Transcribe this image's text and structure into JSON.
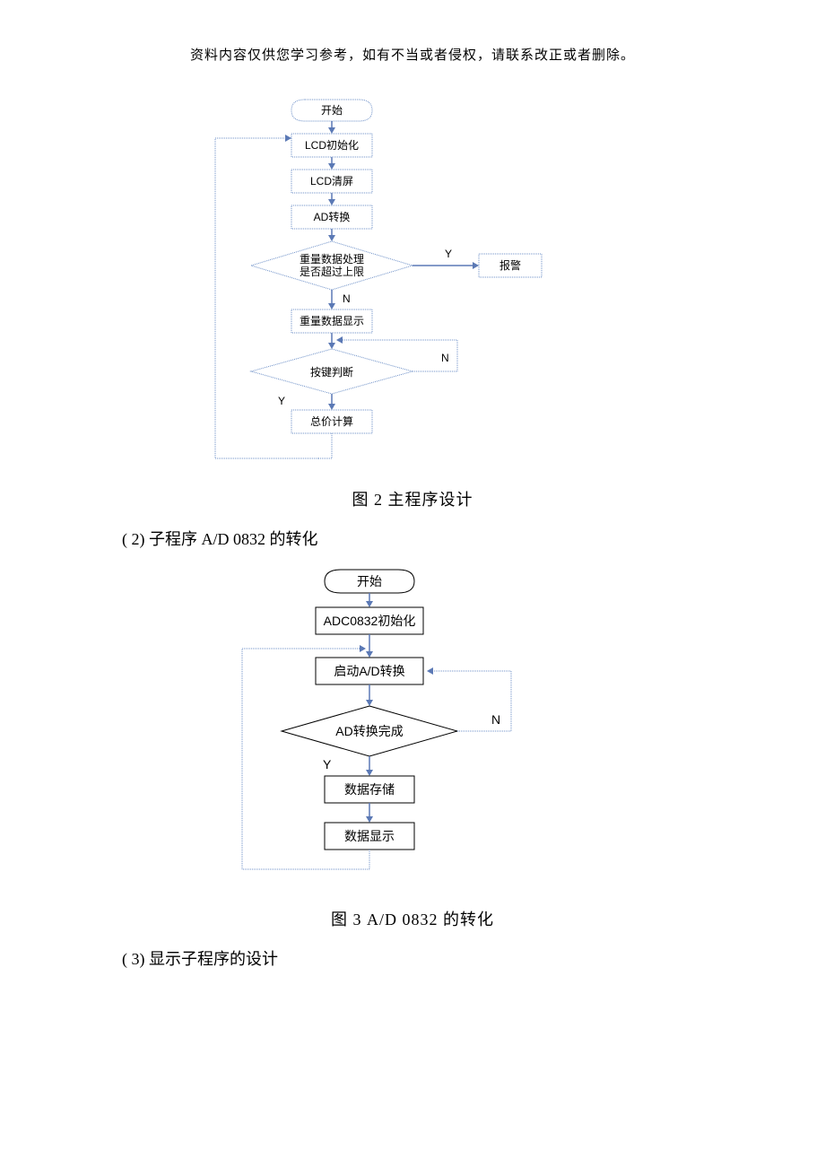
{
  "header": {
    "note": "资料内容仅供您学习参考，如有不当或者侵权，请联系改正或者删除。"
  },
  "flowchart1": {
    "start": "开始",
    "lcd_init": "LCD初始化",
    "lcd_clear": "LCD清屏",
    "ad_convert": "AD转换",
    "weight_process_line1": "重量数据处理",
    "weight_process_line2": "是否超过上限",
    "alarm": "报警",
    "weight_display": "重量数据显示",
    "key_check": "按键判断",
    "total_calc": "总价计算",
    "yes": "Y",
    "no": "N",
    "caption": "图 2   主程序设计"
  },
  "section2": {
    "heading": "( 2)  子程序 A/D 0832 的转化"
  },
  "flowchart2": {
    "start": "开始",
    "adc_init": "ADC0832初始化",
    "start_ad": "启动A/D转换",
    "ad_done": "AD转换完成",
    "data_store": "数据存储",
    "data_display": "数据显示",
    "yes": "Y",
    "no": "N",
    "caption": "图 3    A/D 0832 的转化"
  },
  "section3": {
    "heading": "( 3)  显示子程序的设计"
  }
}
